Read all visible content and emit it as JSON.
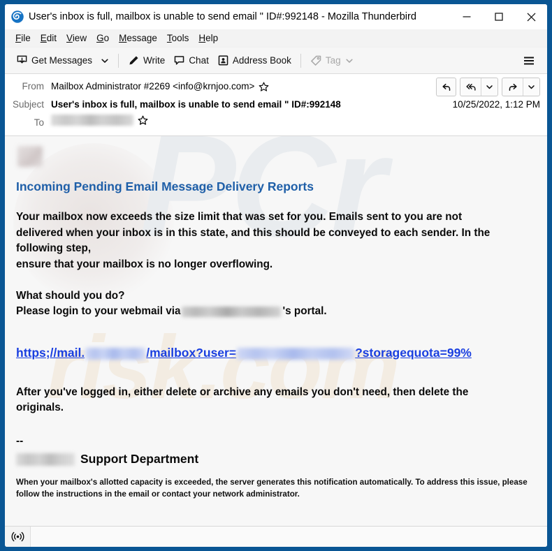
{
  "window": {
    "title": "User's inbox is full, mailbox is unable to send email \" ID#:992148 - Mozilla Thunderbird",
    "logo_icon": "thunderbird-logo-icon",
    "controls": {
      "minimize": "minimize-icon",
      "maximize": "maximize-icon",
      "close": "close-icon"
    }
  },
  "menubar": {
    "items": [
      {
        "label": "File",
        "accesskey": "F"
      },
      {
        "label": "Edit",
        "accesskey": "E"
      },
      {
        "label": "View",
        "accesskey": "V"
      },
      {
        "label": "Go",
        "accesskey": "G"
      },
      {
        "label": "Message",
        "accesskey": "M"
      },
      {
        "label": "Tools",
        "accesskey": "T"
      },
      {
        "label": "Help",
        "accesskey": "H"
      }
    ]
  },
  "toolbar": {
    "get_messages": "Get Messages",
    "get_messages_icon": "inbox-download-icon",
    "get_messages_chevron": "chevron-down-icon",
    "write": "Write",
    "write_icon": "pencil-icon",
    "chat": "Chat",
    "chat_icon": "speech-bubble-icon",
    "address_book": "Address Book",
    "address_book_icon": "contact-card-icon",
    "tag": "Tag",
    "tag_icon": "tag-icon",
    "tag_chevron": "chevron-down-icon",
    "tag_disabled": true,
    "app_menu_icon": "hamburger-menu-icon"
  },
  "message_header": {
    "from_label": "From",
    "from_value": "Mailbox Administrator #2269 <info@krnjoo.com>",
    "from_star_icon": "star-outline-icon",
    "subject_label": "Subject",
    "subject_value": "User's inbox is full, mailbox is unable to send email \" ID#:992148",
    "date": "10/25/2022, 1:12 PM",
    "to_label": "To",
    "to_value_redacted": true,
    "to_star_icon": "star-outline-icon",
    "actions": {
      "reply_icon": "reply-arrow-icon",
      "reply_all_icon": "reply-all-arrow-icon",
      "reply_all_chevron": "chevron-down-icon",
      "forward_icon": "forward-arrow-icon",
      "forward_chevron": "chevron-down-icon"
    }
  },
  "message_body": {
    "sender_logo_redacted": true,
    "heading": "Incoming Pending Email Message Delivery Reports",
    "paragraph_1_line_1": "Your mailbox now exceeds the size limit that was set for you. Emails sent to you are not",
    "paragraph_1_line_2": "delivered when your inbox is in this state, and this should be conveyed to each sender. In the",
    "paragraph_1_line_3": "following step,",
    "paragraph_1_line_4": "ensure that your mailbox is no longer overflowing.",
    "question": "What should you do?",
    "login_prefix": "Please login to your webmail via",
    "login_suffix": "'s portal.",
    "link": {
      "part_1": "https;//mail.",
      "part_2": "/mailbox?user=",
      "part_3": "?storagequota=99%",
      "color": "#1a3fe0"
    },
    "closing_line_1": "After you've logged in, either delete or archive any emails you don't need, then delete the",
    "closing_line_2": "originals.",
    "signature_dashes": "--",
    "signature_name": "Support Department",
    "disclaimer_line_1": "When your mailbox's allotted capacity is exceeded, the server generates this notification automatically. To address this issue, please follow the instructions in",
    "disclaimer_line_2": "the email or contact your network administrator."
  },
  "watermark": {
    "mark_1": "PCr",
    "mark_2": "risk.com"
  },
  "statusbar": {
    "icon": "broadcast-rss-icon",
    "text": ""
  },
  "colors": {
    "window_frame": "#0a5694",
    "heading_blue": "#1f5fa8",
    "link_blue": "#1a3fe0",
    "body_bg": "#f7f7f7",
    "toolbar_bg": "#f6f6f6"
  }
}
